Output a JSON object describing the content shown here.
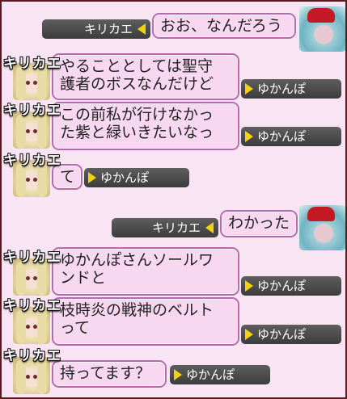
{
  "colors": {
    "background": "#f9e4f3",
    "bubble_fill": "#f7d8f0",
    "bubble_border": "#b46cae",
    "name_tag": "#4a4a4a",
    "arrow": "#f3d20a"
  },
  "messages": [
    {
      "speaker": "キリカエ",
      "text": "おお、なんだろう",
      "to": "キリカエ",
      "side": "right"
    },
    {
      "speaker": "キリカエ",
      "text": "やることとしては聖守\n護者のボスなんだけど",
      "to": "ゆかんぽ",
      "side": "left"
    },
    {
      "speaker": "キリカエ",
      "text": "この前私が行けなかっ\nた紫と緑いきたいなっ",
      "to": "ゆかんぽ",
      "side": "left"
    },
    {
      "speaker": "キリカエ",
      "text": "て",
      "to": "ゆかんぽ",
      "side": "left"
    },
    {
      "speaker": "キリカエ",
      "text": "わかった",
      "to": "キリカエ",
      "side": "right"
    },
    {
      "speaker": "キリカエ",
      "text": "ゆかんぽさんソールワ\nンドと",
      "to": "ゆかんぽ",
      "side": "left"
    },
    {
      "speaker": "キリカエ",
      "text": "枝時炎の戦神のベルト\nって",
      "to": "ゆかんぽ",
      "side": "left"
    },
    {
      "speaker": "キリカエ",
      "text": "持ってます？",
      "to": "ゆかんぽ",
      "side": "left"
    }
  ]
}
